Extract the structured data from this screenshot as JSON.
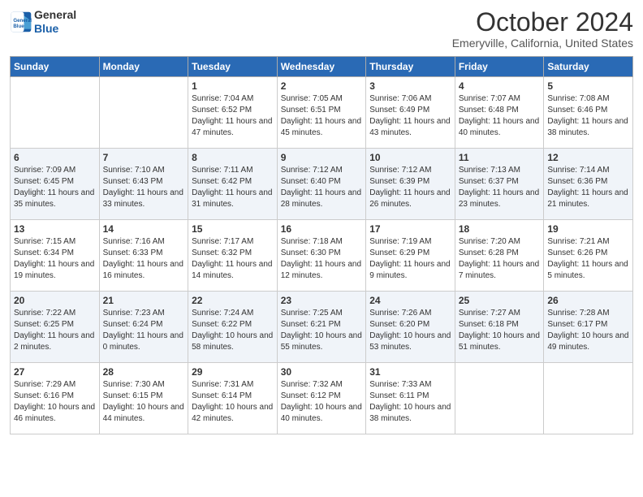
{
  "header": {
    "logo_line1": "General",
    "logo_line2": "Blue",
    "month_title": "October 2024",
    "location": "Emeryville, California, United States"
  },
  "weekdays": [
    "Sunday",
    "Monday",
    "Tuesday",
    "Wednesday",
    "Thursday",
    "Friday",
    "Saturday"
  ],
  "weeks": [
    [
      {
        "day": "",
        "sunrise": "",
        "sunset": "",
        "daylight": ""
      },
      {
        "day": "",
        "sunrise": "",
        "sunset": "",
        "daylight": ""
      },
      {
        "day": "1",
        "sunrise": "Sunrise: 7:04 AM",
        "sunset": "Sunset: 6:52 PM",
        "daylight": "Daylight: 11 hours and 47 minutes."
      },
      {
        "day": "2",
        "sunrise": "Sunrise: 7:05 AM",
        "sunset": "Sunset: 6:51 PM",
        "daylight": "Daylight: 11 hours and 45 minutes."
      },
      {
        "day": "3",
        "sunrise": "Sunrise: 7:06 AM",
        "sunset": "Sunset: 6:49 PM",
        "daylight": "Daylight: 11 hours and 43 minutes."
      },
      {
        "day": "4",
        "sunrise": "Sunrise: 7:07 AM",
        "sunset": "Sunset: 6:48 PM",
        "daylight": "Daylight: 11 hours and 40 minutes."
      },
      {
        "day": "5",
        "sunrise": "Sunrise: 7:08 AM",
        "sunset": "Sunset: 6:46 PM",
        "daylight": "Daylight: 11 hours and 38 minutes."
      }
    ],
    [
      {
        "day": "6",
        "sunrise": "Sunrise: 7:09 AM",
        "sunset": "Sunset: 6:45 PM",
        "daylight": "Daylight: 11 hours and 35 minutes."
      },
      {
        "day": "7",
        "sunrise": "Sunrise: 7:10 AM",
        "sunset": "Sunset: 6:43 PM",
        "daylight": "Daylight: 11 hours and 33 minutes."
      },
      {
        "day": "8",
        "sunrise": "Sunrise: 7:11 AM",
        "sunset": "Sunset: 6:42 PM",
        "daylight": "Daylight: 11 hours and 31 minutes."
      },
      {
        "day": "9",
        "sunrise": "Sunrise: 7:12 AM",
        "sunset": "Sunset: 6:40 PM",
        "daylight": "Daylight: 11 hours and 28 minutes."
      },
      {
        "day": "10",
        "sunrise": "Sunrise: 7:12 AM",
        "sunset": "Sunset: 6:39 PM",
        "daylight": "Daylight: 11 hours and 26 minutes."
      },
      {
        "day": "11",
        "sunrise": "Sunrise: 7:13 AM",
        "sunset": "Sunset: 6:37 PM",
        "daylight": "Daylight: 11 hours and 23 minutes."
      },
      {
        "day": "12",
        "sunrise": "Sunrise: 7:14 AM",
        "sunset": "Sunset: 6:36 PM",
        "daylight": "Daylight: 11 hours and 21 minutes."
      }
    ],
    [
      {
        "day": "13",
        "sunrise": "Sunrise: 7:15 AM",
        "sunset": "Sunset: 6:34 PM",
        "daylight": "Daylight: 11 hours and 19 minutes."
      },
      {
        "day": "14",
        "sunrise": "Sunrise: 7:16 AM",
        "sunset": "Sunset: 6:33 PM",
        "daylight": "Daylight: 11 hours and 16 minutes."
      },
      {
        "day": "15",
        "sunrise": "Sunrise: 7:17 AM",
        "sunset": "Sunset: 6:32 PM",
        "daylight": "Daylight: 11 hours and 14 minutes."
      },
      {
        "day": "16",
        "sunrise": "Sunrise: 7:18 AM",
        "sunset": "Sunset: 6:30 PM",
        "daylight": "Daylight: 11 hours and 12 minutes."
      },
      {
        "day": "17",
        "sunrise": "Sunrise: 7:19 AM",
        "sunset": "Sunset: 6:29 PM",
        "daylight": "Daylight: 11 hours and 9 minutes."
      },
      {
        "day": "18",
        "sunrise": "Sunrise: 7:20 AM",
        "sunset": "Sunset: 6:28 PM",
        "daylight": "Daylight: 11 hours and 7 minutes."
      },
      {
        "day": "19",
        "sunrise": "Sunrise: 7:21 AM",
        "sunset": "Sunset: 6:26 PM",
        "daylight": "Daylight: 11 hours and 5 minutes."
      }
    ],
    [
      {
        "day": "20",
        "sunrise": "Sunrise: 7:22 AM",
        "sunset": "Sunset: 6:25 PM",
        "daylight": "Daylight: 11 hours and 2 minutes."
      },
      {
        "day": "21",
        "sunrise": "Sunrise: 7:23 AM",
        "sunset": "Sunset: 6:24 PM",
        "daylight": "Daylight: 11 hours and 0 minutes."
      },
      {
        "day": "22",
        "sunrise": "Sunrise: 7:24 AM",
        "sunset": "Sunset: 6:22 PM",
        "daylight": "Daylight: 10 hours and 58 minutes."
      },
      {
        "day": "23",
        "sunrise": "Sunrise: 7:25 AM",
        "sunset": "Sunset: 6:21 PM",
        "daylight": "Daylight: 10 hours and 55 minutes."
      },
      {
        "day": "24",
        "sunrise": "Sunrise: 7:26 AM",
        "sunset": "Sunset: 6:20 PM",
        "daylight": "Daylight: 10 hours and 53 minutes."
      },
      {
        "day": "25",
        "sunrise": "Sunrise: 7:27 AM",
        "sunset": "Sunset: 6:18 PM",
        "daylight": "Daylight: 10 hours and 51 minutes."
      },
      {
        "day": "26",
        "sunrise": "Sunrise: 7:28 AM",
        "sunset": "Sunset: 6:17 PM",
        "daylight": "Daylight: 10 hours and 49 minutes."
      }
    ],
    [
      {
        "day": "27",
        "sunrise": "Sunrise: 7:29 AM",
        "sunset": "Sunset: 6:16 PM",
        "daylight": "Daylight: 10 hours and 46 minutes."
      },
      {
        "day": "28",
        "sunrise": "Sunrise: 7:30 AM",
        "sunset": "Sunset: 6:15 PM",
        "daylight": "Daylight: 10 hours and 44 minutes."
      },
      {
        "day": "29",
        "sunrise": "Sunrise: 7:31 AM",
        "sunset": "Sunset: 6:14 PM",
        "daylight": "Daylight: 10 hours and 42 minutes."
      },
      {
        "day": "30",
        "sunrise": "Sunrise: 7:32 AM",
        "sunset": "Sunset: 6:12 PM",
        "daylight": "Daylight: 10 hours and 40 minutes."
      },
      {
        "day": "31",
        "sunrise": "Sunrise: 7:33 AM",
        "sunset": "Sunset: 6:11 PM",
        "daylight": "Daylight: 10 hours and 38 minutes."
      },
      {
        "day": "",
        "sunrise": "",
        "sunset": "",
        "daylight": ""
      },
      {
        "day": "",
        "sunrise": "",
        "sunset": "",
        "daylight": ""
      }
    ]
  ]
}
